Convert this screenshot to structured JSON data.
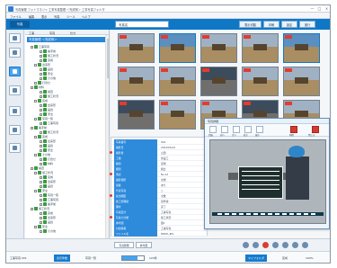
{
  "window": {
    "title": "写真管理 フォトマネジャ 工事写真整理 ＜完成例＞ 工事写真フォルダ",
    "controls": [
      "—",
      "□",
      "×"
    ]
  },
  "menu": [
    "ファイル",
    "編集",
    "表示",
    "写真",
    "ツール",
    "ヘルプ"
  ],
  "toolbar": {
    "tabs": [
      "写真"
    ],
    "search_placeholder": "写真名",
    "buttons": [
      "表示切替",
      "印刷",
      "設定",
      "実行"
    ]
  },
  "tree": {
    "tabs": [
      "工事",
      "写真",
      "仕分"
    ],
    "root": "写真管理 ＜完成例＞",
    "rows": [
      "工事写真",
      "着手前",
      "施工状況",
      "完成",
      "出来形",
      "品質",
      "安全",
      "その他",
      "打合せ",
      "材料",
      "検査",
      "施工状況",
      "完成",
      "出来形",
      "品質",
      "安全",
      "写真一覧",
      "工事写真",
      "着手前",
      "施工状況",
      "完成",
      "出来形",
      "品質",
      "安全",
      "その他",
      "打合せ",
      "材料",
      "検査",
      "施工状況",
      "完成",
      "出来形",
      "品質",
      "安全",
      "写真一覧",
      "工事写真",
      "着手前",
      "施工状況",
      "完成",
      "出来形",
      "品質",
      "安全",
      "その他"
    ]
  },
  "details": {
    "rows": [
      {
        "key": "写真番号",
        "value": "001"
      },
      {
        "key": "撮影日",
        "value": "2023/05/12"
      },
      {
        "key": "撮影者",
        "value": "山田"
      },
      {
        "key": "工種",
        "value": "仮設工"
      },
      {
        "key": "種別",
        "value": "足場"
      },
      {
        "key": "細別",
        "value": "組立"
      },
      {
        "key": "測点",
        "value": "No.12"
      },
      {
        "key": "撮影箇所",
        "value": "北側"
      },
      {
        "key": "黒板",
        "value": "あり"
      },
      {
        "key": "代表写真",
        "value": "○"
      },
      {
        "key": "提出頻度",
        "value": "全数"
      },
      {
        "key": "施工管理値",
        "value": "基準値"
      },
      {
        "key": "備考",
        "value": "完了"
      },
      {
        "key": "写真区分",
        "value": "工事写真"
      },
      {
        "key": "写真大分類",
        "value": "施工状況"
      },
      {
        "key": "参考図",
        "value": "図1"
      },
      {
        "key": "付加情報",
        "value": "工事写真"
      },
      {
        "key": "ファイル名",
        "value": "P0001.JPG"
      }
    ]
  },
  "popup": {
    "title": "写真詳細",
    "buttons": [
      "回転",
      "前へ",
      "次へ",
      "拡大",
      "縮小",
      "削除",
      "閉じる"
    ]
  },
  "bottom": {
    "buttons": [
      "写真整理",
      "参考図"
    ],
    "icons": [
      "help-icon",
      "photo-icon",
      "print-icon",
      "settings-icon",
      "close-icon",
      "link-icon",
      "search-icon"
    ]
  },
  "status": {
    "items": [
      "工事写真 001",
      "表示件数",
      "写真一覧",
      "120件",
      "マイフォルダ",
      "完成"
    ],
    "progress": 0.72,
    "zoom": "100%"
  }
}
